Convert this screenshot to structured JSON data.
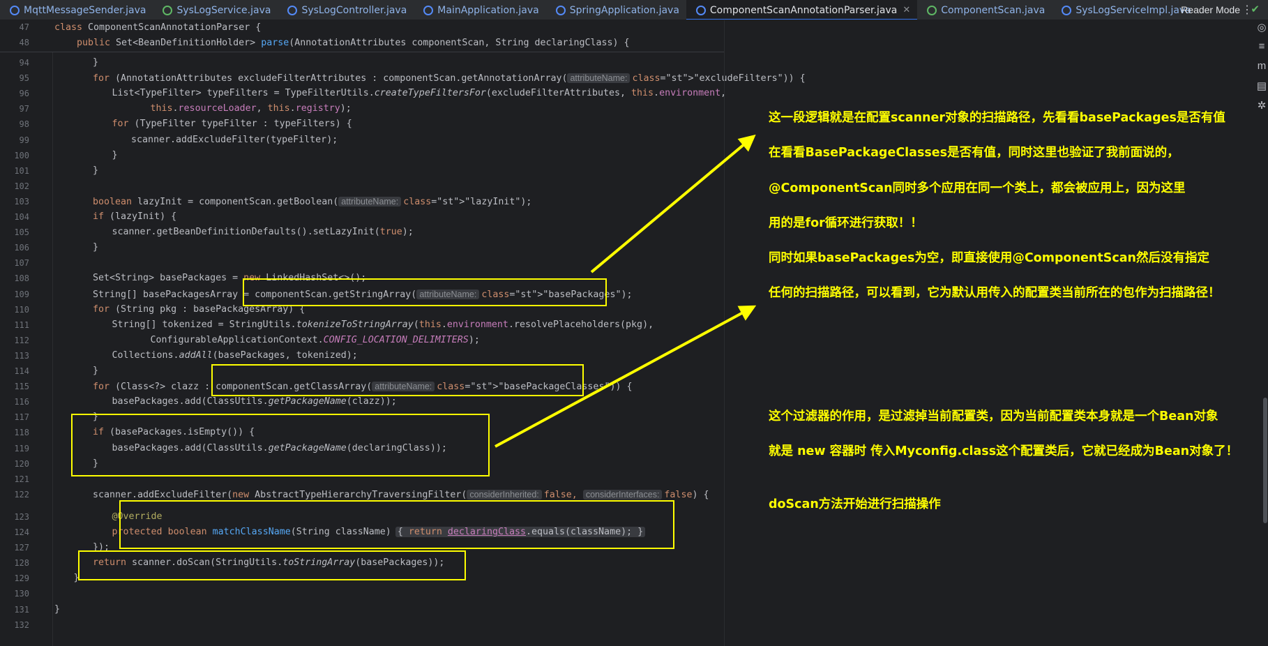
{
  "tabs": [
    {
      "label": "MqttMessageSender.java",
      "color": "#548af7"
    },
    {
      "label": "SysLogService.java",
      "color": "#5fb865"
    },
    {
      "label": "SysLogController.java",
      "color": "#548af7"
    },
    {
      "label": "MainApplication.java",
      "color": "#548af7"
    },
    {
      "label": "SpringApplication.java",
      "color": "#548af7"
    },
    {
      "label": "ComponentScanAnnotationParser.java",
      "color": "#548af7",
      "active": true
    },
    {
      "label": "ComponentScan.java",
      "color": "#5fb865"
    },
    {
      "label": "SysLogServiceImpl.java",
      "color": "#548af7"
    }
  ],
  "editor": {
    "reader_mode": "Reader Mode",
    "sticky": [
      {
        "no": "47",
        "code": "class ComponentScanAnnotationParser {"
      },
      {
        "no": "48",
        "code": "public Set<BeanDefinitionHolder> parse(AnnotationAttributes componentScan, String declaringClass) {"
      }
    ],
    "lines": [
      {
        "no": "94",
        "code": "}"
      },
      {
        "no": "95",
        "code": "for (AnnotationAttributes excludeFilterAttributes : componentScan.getAnnotationArray(",
        "hint": "attributeName:",
        "tail": "\"excludeFilters\")) {"
      },
      {
        "no": "96",
        "code": "List<TypeFilter> typeFilters = TypeFilterUtils.createTypeFiltersFor(excludeFilterAttributes, this.environment,"
      },
      {
        "no": "97",
        "code": "this.resourceLoader, this.registry);"
      },
      {
        "no": "98",
        "code": "for (TypeFilter typeFilter : typeFilters) {"
      },
      {
        "no": "99",
        "code": "scanner.addExcludeFilter(typeFilter);"
      },
      {
        "no": "100",
        "code": "}"
      },
      {
        "no": "101",
        "code": "}"
      },
      {
        "no": "102",
        "code": ""
      },
      {
        "no": "103",
        "code": "boolean lazyInit = componentScan.getBoolean(",
        "hint": "attributeName:",
        "tail": "\"lazyInit\");"
      },
      {
        "no": "104",
        "code": "if (lazyInit) {"
      },
      {
        "no": "105",
        "code": "scanner.getBeanDefinitionDefaults().setLazyInit(true);"
      },
      {
        "no": "106",
        "code": "}"
      },
      {
        "no": "107",
        "code": ""
      },
      {
        "no": "108",
        "code": "Set<String> basePackages = new LinkedHashSet<>();"
      },
      {
        "no": "109",
        "code": "String[] basePackagesArray = componentScan.getStringArray(",
        "hint": "attributeName:",
        "tail": "\"basePackages\");"
      },
      {
        "no": "110",
        "code": "for (String pkg : basePackagesArray) {"
      },
      {
        "no": "111",
        "code": "String[] tokenized = StringUtils.tokenizeToStringArray(this.environment.resolvePlaceholders(pkg),"
      },
      {
        "no": "112",
        "code": "ConfigurableApplicationContext.CONFIG_LOCATION_DELIMITERS);"
      },
      {
        "no": "113",
        "code": "Collections.addAll(basePackages, tokenized);"
      },
      {
        "no": "114",
        "code": "}"
      },
      {
        "no": "115",
        "code": "for (Class<?> clazz : componentScan.getClassArray(",
        "hint": "attributeName:",
        "tail": "\"basePackageClasses\")) {"
      },
      {
        "no": "116",
        "code": "basePackages.add(ClassUtils.getPackageName(clazz));"
      },
      {
        "no": "117",
        "code": "}"
      },
      {
        "no": "118",
        "code": "if (basePackages.isEmpty()) {"
      },
      {
        "no": "119",
        "code": "basePackages.add(ClassUtils.getPackageName(declaringClass));"
      },
      {
        "no": "120",
        "code": "}"
      },
      {
        "no": "121",
        "code": ""
      },
      {
        "no": "122",
        "code": "scanner.addExcludeFilter(new AbstractTypeHierarchyTraversingFilter(",
        "hint": "considerInherited:",
        "mid": "false,",
        "hint2": "considerInterfaces:",
        "tail": "false) {"
      },
      {
        "no": "123",
        "code": "@Override"
      },
      {
        "no": "124",
        "code": "protected boolean matchClassName(String className)",
        "tail": "{ return declaringClass.equals(className); }"
      },
      {
        "no": "127",
        "code": "});"
      },
      {
        "no": "128",
        "code": "return scanner.doScan(StringUtils.toStringArray(basePackages));"
      },
      {
        "no": "129",
        "code": "}"
      },
      {
        "no": "130",
        "code": ""
      },
      {
        "no": "131",
        "code": "}"
      },
      {
        "no": "132",
        "code": ""
      }
    ]
  },
  "notes": [
    "这一段逻辑就是在配置scanner对象的扫描路径，先看看basePackages是否有值",
    "在看看BasePackageClasses是否有值，同时这里也验证了我前面说的，",
    "@ComponentScan同时多个应用在同一个类上，都会被应用上，因为这里",
    "用的是for循环进行获取！！",
    "同时如果basePackages为空，即直接使用@ComponentScan然后没有指定",
    "任何的扫描路径，可以看到，它为默认用传入的配置类当前所在的包作为扫描路径！",
    "这个过滤器的作用，是过滤掉当前配置类，因为当前配置类本身就是一个Bean对象",
    "就是 new 容器时 传入Myconfig.class这个配置类后，它就已经成为Bean对象了！",
    "doScan方法开始进行扫描操作"
  ],
  "colors": {
    "annotation": "#ffff00",
    "tab_accent": "#3574f0"
  }
}
